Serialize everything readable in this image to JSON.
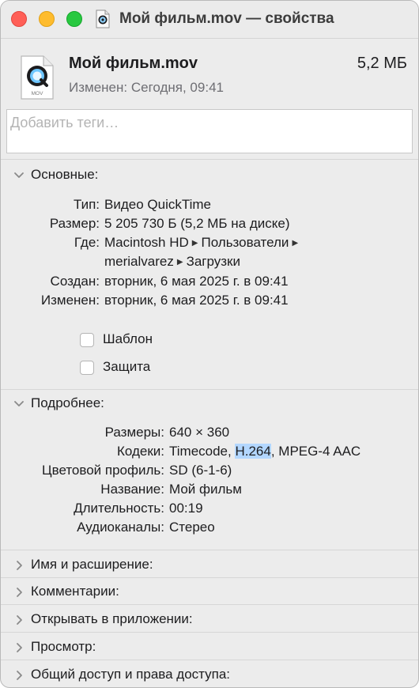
{
  "window": {
    "title": "Мой фильм.mov — свойства"
  },
  "header": {
    "file_name": "Мой фильм.mov",
    "file_size": "5,2 МБ",
    "modified": "Изменен: Сегодня, 09:41",
    "icon_label": "MOV"
  },
  "tags": {
    "placeholder": "Добавить теги…"
  },
  "general": {
    "title": "Основные:",
    "rows": [
      {
        "label": "Тип:",
        "value": "Видео QuickTime"
      },
      {
        "label": "Размер:",
        "value": "5 205 730 Б (5,2 МБ на диске)"
      },
      {
        "label": "Где:",
        "value_parts": [
          "Macintosh HD",
          "Пользователи",
          "merialvarez",
          "Загрузки"
        ]
      },
      {
        "label": "Создан:",
        "value": "вторник, 6 мая 2025 г. в 09:41"
      },
      {
        "label": "Изменен:",
        "value": "вторник, 6 мая 2025 г. в 09:41"
      }
    ],
    "checkboxes": [
      {
        "label": "Шаблон",
        "checked": false
      },
      {
        "label": "Защита",
        "checked": false
      }
    ]
  },
  "more_info": {
    "title": "Подробнее:",
    "rows": [
      {
        "label": "Размеры:",
        "value": "640 × 360"
      },
      {
        "label": "Кодеки:",
        "value_before": "Timecode, ",
        "value_highlight": "H.264",
        "value_after": ", MPEG-4 AAC"
      },
      {
        "label": "Цветовой профиль:",
        "value": "SD (6-1-6)"
      },
      {
        "label": "Название:",
        "value": "Мой фильм"
      },
      {
        "label": "Длительность:",
        "value": "00:19"
      },
      {
        "label": "Аудиоканалы:",
        "value": "Стерео"
      }
    ]
  },
  "collapsed_sections": [
    {
      "title": "Имя и расширение:"
    },
    {
      "title": "Комментарии:"
    },
    {
      "title": "Открывать в приложении:"
    },
    {
      "title": "Просмотр:"
    },
    {
      "title": "Общий доступ и права доступа:"
    }
  ],
  "colors": {
    "close": "#ff5f57",
    "minimize": "#febc2e",
    "zoom": "#28c840",
    "selection": "#b3d7ff",
    "secondary_text": "#6e6e73"
  }
}
